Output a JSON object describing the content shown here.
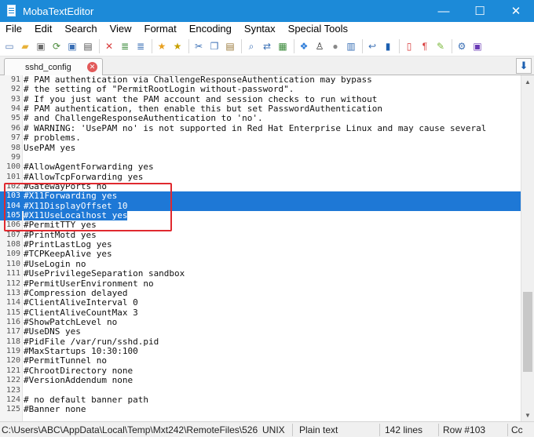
{
  "window": {
    "title": "MobaTextEditor",
    "minimize_glyph": "—",
    "maximize_glyph": "☐",
    "close_glyph": "✕"
  },
  "menu": [
    "File",
    "Edit",
    "Search",
    "View",
    "Format",
    "Encoding",
    "Syntax",
    "Special Tools"
  ],
  "toolbar_icons": [
    {
      "name": "new-file-icon",
      "glyph": "▭",
      "color": "#5a7fb8"
    },
    {
      "name": "open-folder-icon",
      "glyph": "▰",
      "color": "#e8b23a"
    },
    {
      "name": "save-icon",
      "glyph": "▣",
      "color": "#6b6b6b"
    },
    {
      "name": "reload-icon",
      "glyph": "⟳",
      "color": "#4a8a3a"
    },
    {
      "name": "save-as-icon",
      "glyph": "▣",
      "color": "#3a6fb5"
    },
    {
      "name": "print-icon",
      "glyph": "▤",
      "color": "#555555"
    },
    {
      "name": "close-file-icon",
      "glyph": "✕",
      "color": "#d83a3a"
    },
    {
      "name": "cut-lines-icon",
      "glyph": "≣",
      "color": "#3a8a3a"
    },
    {
      "name": "copy-lines-icon",
      "glyph": "≣",
      "color": "#3a6fb5"
    },
    {
      "name": "bookmark-star-icon",
      "glyph": "★",
      "color": "#e8a020"
    },
    {
      "name": "bookmark-next-icon",
      "glyph": "★",
      "color": "#c8a000"
    },
    {
      "name": "cut-icon",
      "glyph": "✂",
      "color": "#3a6fb5"
    },
    {
      "name": "copy-icon",
      "glyph": "❐",
      "color": "#3a6fb5"
    },
    {
      "name": "paste-icon",
      "glyph": "▤",
      "color": "#9a7a3a"
    },
    {
      "name": "find-icon",
      "glyph": "⌕",
      "color": "#3a6fb5"
    },
    {
      "name": "replace-icon",
      "glyph": "⇄",
      "color": "#3a6fb5"
    },
    {
      "name": "goto-icon",
      "glyph": "▦",
      "color": "#3a8a3a"
    },
    {
      "name": "windows-eol-icon",
      "glyph": "❖",
      "color": "#2a7ad8"
    },
    {
      "name": "linux-eol-icon",
      "glyph": "♙",
      "color": "#222222"
    },
    {
      "name": "mac-eol-icon",
      "glyph": "●",
      "color": "#888888"
    },
    {
      "name": "unix-ff-icon",
      "glyph": "▥",
      "color": "#3a6fb5"
    },
    {
      "name": "word-wrap-icon",
      "glyph": "↩",
      "color": "#3a6fb5"
    },
    {
      "name": "split-view-icon",
      "glyph": "▮",
      "color": "#1c5fb0"
    },
    {
      "name": "case-icon",
      "glyph": "▯",
      "color": "#d83a3a"
    },
    {
      "name": "paragraph-marks-icon",
      "glyph": "¶",
      "color": "#d83a3a"
    },
    {
      "name": "highlight-icon",
      "glyph": "✎",
      "color": "#7ab83a"
    },
    {
      "name": "settings-icon",
      "glyph": "⚙",
      "color": "#3a6fb5"
    },
    {
      "name": "exit-icon",
      "glyph": "▣",
      "color": "#6a3ab5"
    }
  ],
  "tab": {
    "label": "sshd_config",
    "close_glyph": "✕",
    "menu_glyph": "⬇"
  },
  "editor": {
    "lines": [
      {
        "n": "91",
        "text": "# PAM authentication via ChallengeResponseAuthentication may bypass"
      },
      {
        "n": "92",
        "text": "# the setting of \"PermitRootLogin without-password\"."
      },
      {
        "n": "93",
        "text": "# If you just want the PAM account and session checks to run without"
      },
      {
        "n": "94",
        "text": "# PAM authentication, then enable this but set PasswordAuthentication"
      },
      {
        "n": "95",
        "text": "# and ChallengeResponseAuthentication to 'no'."
      },
      {
        "n": "96",
        "text": "# WARNING: 'UsePAM no' is not supported in Red Hat Enterprise Linux and may cause several"
      },
      {
        "n": "97",
        "text": "# problems."
      },
      {
        "n": "98",
        "text": "UsePAM yes"
      },
      {
        "n": "99",
        "text": ""
      },
      {
        "n": "100",
        "text": "#AllowAgentForwarding yes"
      },
      {
        "n": "101",
        "text": "#AllowTcpForwarding yes"
      },
      {
        "n": "102",
        "text": "#GatewayPorts no"
      },
      {
        "n": "103",
        "text": "#X11Forwarding yes",
        "sel": "full"
      },
      {
        "n": "104",
        "text": "#X11DisplayOffset 10",
        "sel": "full"
      },
      {
        "n": "105",
        "text": "#X11UseLocalhost yes",
        "sel": "partial"
      },
      {
        "n": "106",
        "text": "#PermitTTY yes"
      },
      {
        "n": "107",
        "text": "#PrintMotd yes"
      },
      {
        "n": "108",
        "text": "#PrintLastLog yes"
      },
      {
        "n": "109",
        "text": "#TCPKeepAlive yes"
      },
      {
        "n": "110",
        "text": "#UseLogin no"
      },
      {
        "n": "111",
        "text": "#UsePrivilegeSeparation sandbox"
      },
      {
        "n": "112",
        "text": "#PermitUserEnvironment no"
      },
      {
        "n": "113",
        "text": "#Compression delayed"
      },
      {
        "n": "114",
        "text": "#ClientAliveInterval 0"
      },
      {
        "n": "115",
        "text": "#ClientAliveCountMax 3"
      },
      {
        "n": "116",
        "text": "#ShowPatchLevel no"
      },
      {
        "n": "117",
        "text": "#UseDNS yes"
      },
      {
        "n": "118",
        "text": "#PidFile /var/run/sshd.pid"
      },
      {
        "n": "119",
        "text": "#MaxStartups 10:30:100"
      },
      {
        "n": "120",
        "text": "#PermitTunnel no"
      },
      {
        "n": "121",
        "text": "#ChrootDirectory none"
      },
      {
        "n": "122",
        "text": "#VersionAddendum none"
      },
      {
        "n": "123",
        "text": ""
      },
      {
        "n": "124",
        "text": "# no default banner path"
      },
      {
        "n": "125",
        "text": "#Banner none"
      }
    ]
  },
  "scrollbar": {
    "up_glyph": "▲",
    "down_glyph": "▼"
  },
  "status": {
    "path": "C:\\Users\\ABC\\AppData\\Local\\Temp\\Mxt242\\RemoteFiles\\526",
    "eol": "UNIX",
    "mode": "Plain text",
    "lines": "142 lines",
    "row": "Row #103",
    "col": "Cc"
  },
  "colors": {
    "titlebar": "#1c8ad8",
    "selection": "#1e78d6",
    "annotation_box": "#e0292f"
  }
}
